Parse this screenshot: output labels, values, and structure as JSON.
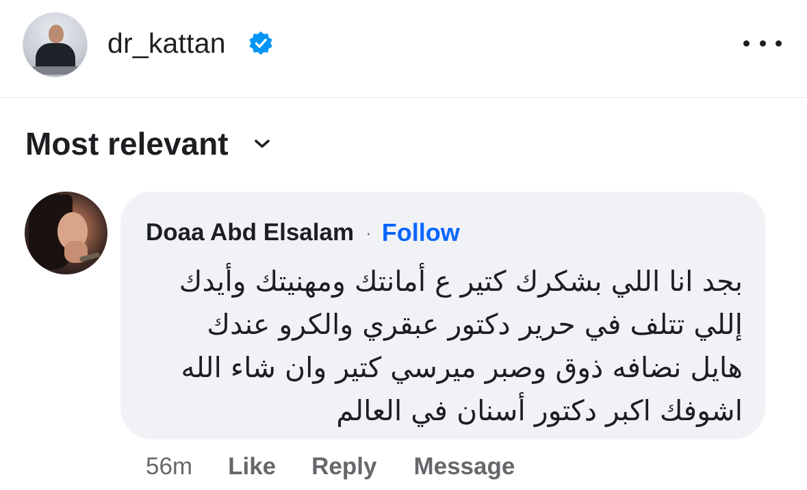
{
  "post_header": {
    "username": "dr_kattan",
    "verified_icon": "verified-badge-icon",
    "more_icon": "more-options-icon"
  },
  "sort": {
    "label": "Most relevant",
    "icon": "chevron-down-icon"
  },
  "comment": {
    "author": "Doaa Abd Elsalam",
    "separator": "·",
    "follow_label": "Follow",
    "text": "بجد انا اللي بشكرك كتير ع أمانتك ومهنيتك وأيدك إللي تتلف في حرير دكتور عبقري والكرو عندك هايل نضافه ذوق وصبر ميرسي كتير وان شاء الله اشوفك اكبر دكتور أسنان في العالم",
    "timestamp": "56m",
    "like_label": "Like",
    "reply_label": "Reply",
    "message_label": "Message"
  },
  "colors": {
    "accent": "#0866ff",
    "verified": "#0095f6",
    "bubble": "#f0f2f5",
    "secondary_text": "#65676b"
  }
}
